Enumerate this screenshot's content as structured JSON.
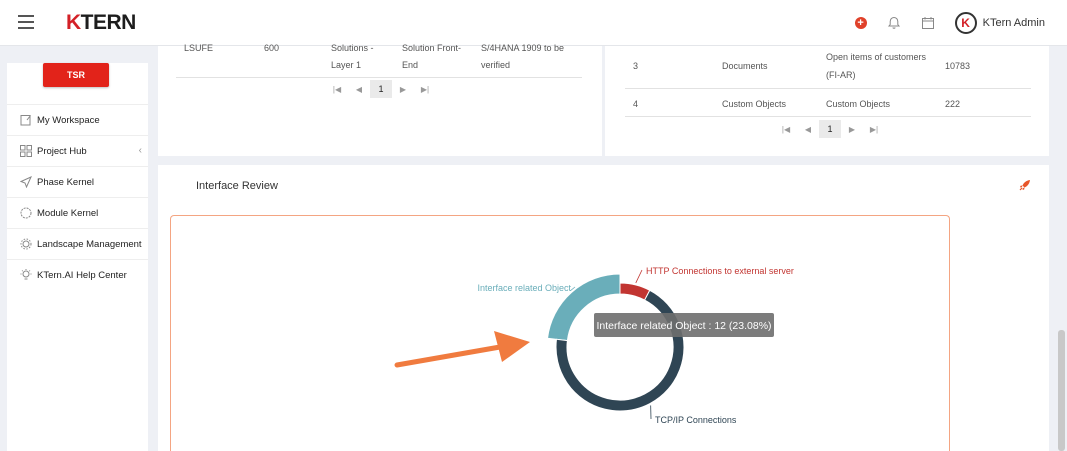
{
  "header": {
    "logo_k": "K",
    "logo_rest": "TERN",
    "admin_name": "KTern Admin",
    "avatar_letter": "K"
  },
  "sidebar": {
    "tsr_label": "TSR",
    "items": [
      {
        "label": "My Workspace",
        "icon": "notepad-icon"
      },
      {
        "label": "Project Hub",
        "icon": "grid-icon"
      },
      {
        "label": "Phase Kernel",
        "icon": "send-icon"
      },
      {
        "label": "Module Kernel",
        "icon": "circle-icon"
      },
      {
        "label": "Landscape Management",
        "icon": "gear-icon"
      },
      {
        "label": "KTern.AI Help Center",
        "icon": "lightbulb-icon"
      }
    ]
  },
  "top_left_table": {
    "row_partial": [
      "LSUFE",
      "600",
      "Solutions -",
      "Solution Front-",
      "S/4HANA 1909 to be"
    ],
    "row_second": [
      "Layer 1",
      "End",
      "verified"
    ],
    "page": "1"
  },
  "top_right_table": {
    "rows": [
      {
        "no": "3",
        "type": "Documents",
        "desc_line1": "Open items of customers",
        "desc_line2": "(FI-AR)",
        "count": "10783"
      },
      {
        "no": "4",
        "type": "Custom Objects",
        "desc_line1": "Custom Objects",
        "desc_line2": "",
        "count": "222"
      }
    ],
    "page": "1"
  },
  "review": {
    "title": "Interface Review"
  },
  "chart_data": {
    "type": "pie",
    "donut": true,
    "categories": [
      "Interface related Object",
      "HTTP Connections to external server",
      "TCP/IP Connections"
    ],
    "values": [
      12,
      4,
      36
    ],
    "colors": [
      "#6aaeba",
      "#c23531",
      "#2f4554"
    ],
    "tooltip": "Interface related Object : 12 (23.08%)"
  }
}
